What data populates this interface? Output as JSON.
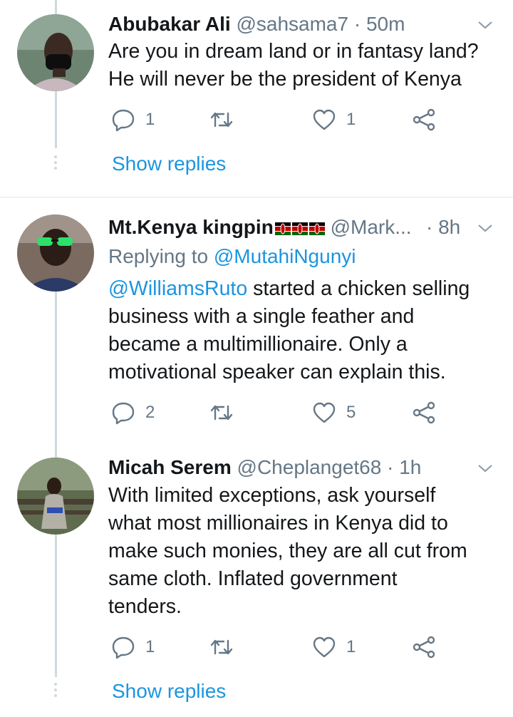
{
  "tweets": [
    {
      "name": "Abubakar Ali",
      "handle": "@sahsama7",
      "time": "· 50m",
      "lines": [
        "Are you in dream land or in fantasy land?",
        "He will never be the president of Kenya"
      ],
      "replies": "1",
      "retweets": "",
      "likes": "1",
      "show_replies": "Show replies"
    },
    {
      "name": "Mt.Kenya kingpin",
      "handle": "@Mark...",
      "time": "· 8h",
      "replying_prefix": "Replying to",
      "replying_handle": "@MutahiNgunyi",
      "mention": "@WilliamsRuto",
      "line1_rest": " started a chicken selling",
      "lines": [
        "business with a single feather and",
        "became a multimillionaire. Only a",
        "motivational speaker can explain this."
      ],
      "replies": "2",
      "retweets": "",
      "likes": "5"
    },
    {
      "name": "Micah Serem",
      "handle": "@Cheplanget68",
      "time": "· 1h",
      "lines": [
        "With limited exceptions, ask yourself",
        "what most millionaires in Kenya did to",
        "make such monies, they are all cut from",
        "same cloth. Inflated government",
        "tenders."
      ],
      "replies": "1",
      "retweets": "",
      "likes": "1",
      "show_replies": "Show replies"
    }
  ],
  "icons": {
    "reply": "reply-icon",
    "retweet": "retweet-icon",
    "like": "heart-icon",
    "share": "share-icon",
    "more": "chevron-down-icon",
    "flag": "kenya-flag-icon"
  },
  "colors": {
    "link": "#1b95e0",
    "muted": "#657786",
    "text": "#14171a",
    "thread_line": "#cfd9de"
  }
}
